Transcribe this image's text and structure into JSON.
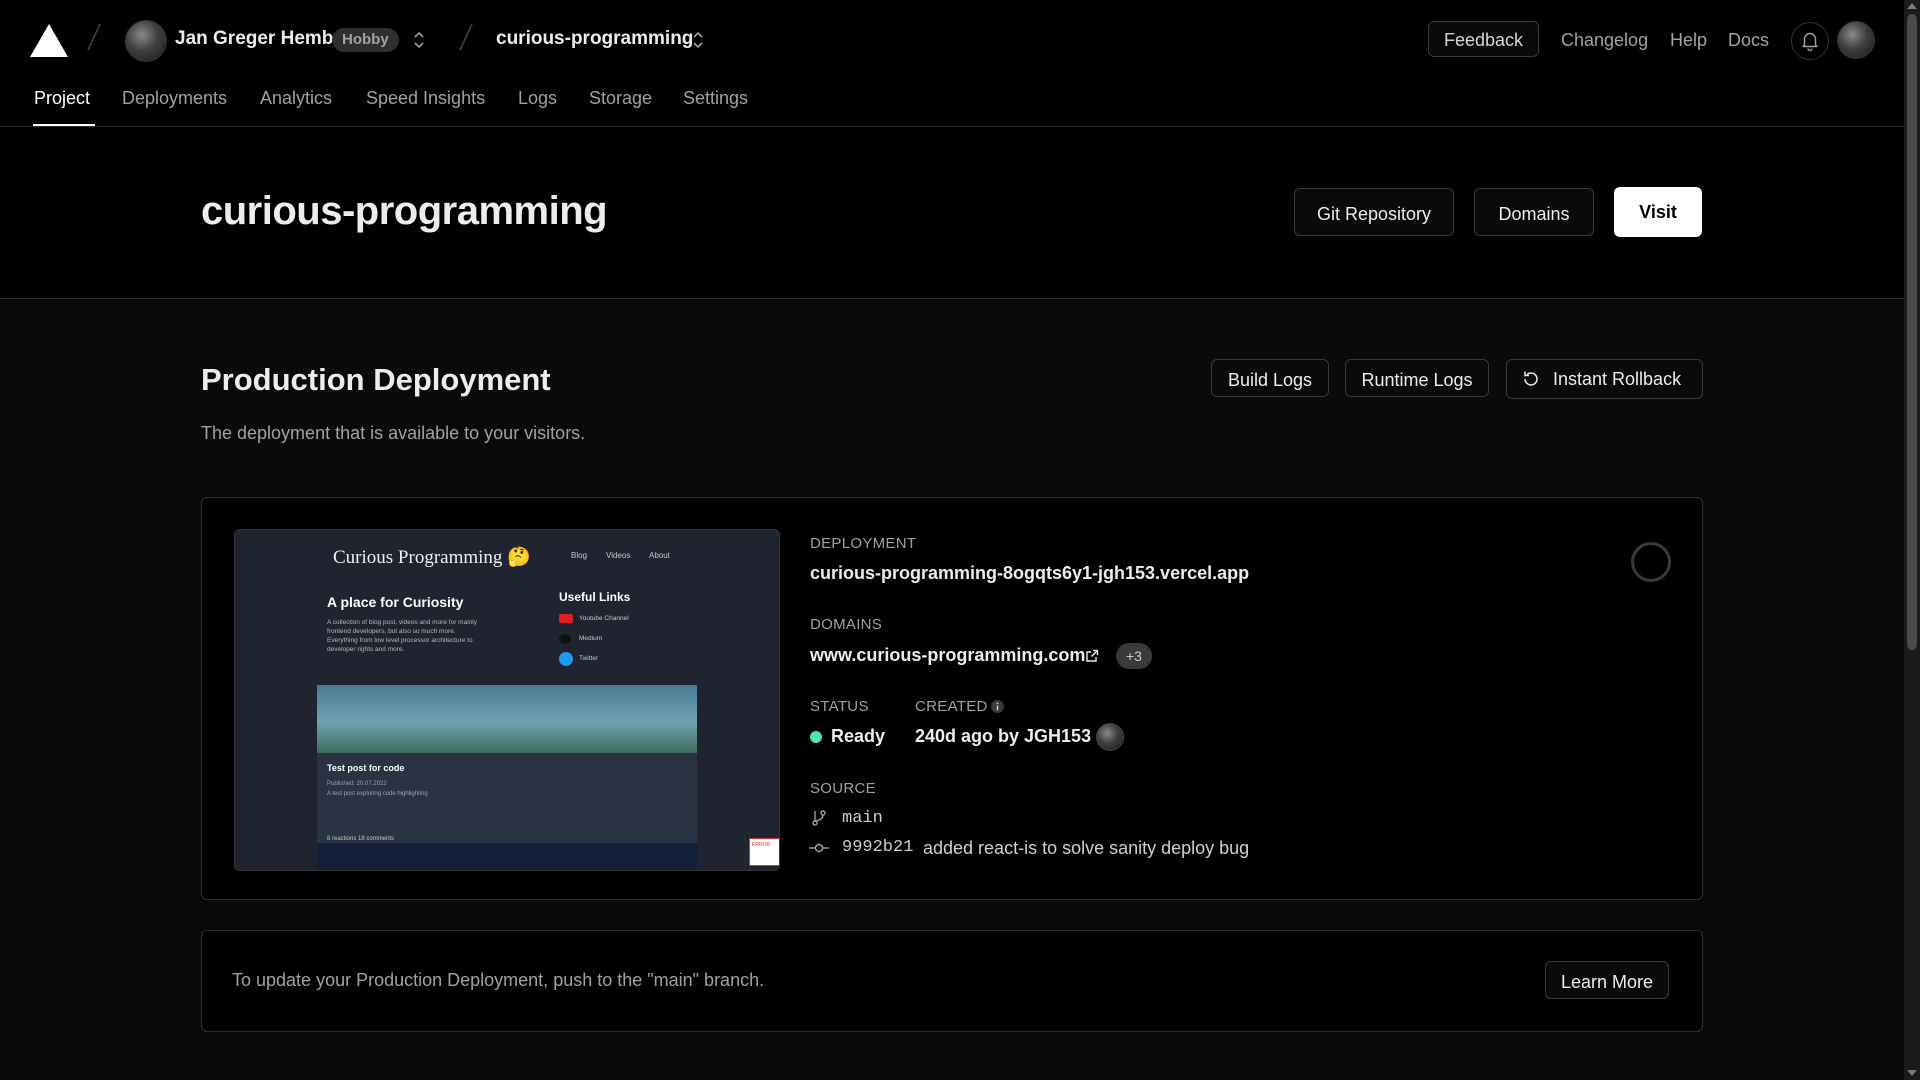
{
  "header": {
    "team_name": "Jan Greger Hemb",
    "plan_badge": "Hobby",
    "project_name": "curious-programming",
    "feedback_label": "Feedback",
    "nav": [
      "Changelog",
      "Help",
      "Docs"
    ]
  },
  "tabs": [
    "Project",
    "Deployments",
    "Analytics",
    "Speed Insights",
    "Logs",
    "Storage",
    "Settings"
  ],
  "title_band": {
    "title": "curious-programming",
    "git_repository_label": "Git Repository",
    "domains_label": "Domains",
    "visit_label": "Visit"
  },
  "production": {
    "title": "Production Deployment",
    "subtitle": "The deployment that is available to your visitors.",
    "build_logs_label": "Build Logs",
    "runtime_logs_label": "Runtime Logs",
    "rollback_label": "Instant Rollback",
    "deployment_label": "DEPLOYMENT",
    "deployment_url": "curious-programming-8ogqts6y1-jgh153.vercel.app",
    "domains_label": "DOMAINS",
    "domain": "www.curious-programming.com",
    "extra_domains": "+3",
    "status_label": "STATUS",
    "status_value": "Ready",
    "created_label": "CREATED",
    "created_value": "240d ago by JGH153",
    "source_label": "SOURCE",
    "branch": "main",
    "commit_hash": "9992b21",
    "commit_message": "added react-is to solve sanity deploy bug",
    "status_color": "#50e3c2"
  },
  "preview": {
    "site_title": "Curious Programming 🤔",
    "nav": [
      "Blog",
      "Videos",
      "About"
    ],
    "hero_heading": "A place for Curiosity",
    "hero_text": "A collection of blog post, videos and more for mainly frontend developers, but also so much more. Everything from low level processor architecture to developer rights and more.",
    "links_heading": "Useful Links",
    "links": [
      "Youtube Channel",
      "Medium",
      "Twitter"
    ],
    "post_title": "Test post for code",
    "post_published": "Published: 20.07.2022",
    "post_desc": "A test post exploring code highlighting",
    "post_reactions": "8 reactions   18 comments",
    "error_text": "ERROR"
  },
  "info": {
    "text": "To update your Production Deployment, push to the \"main\" branch.",
    "learn_more_label": "Learn More"
  }
}
